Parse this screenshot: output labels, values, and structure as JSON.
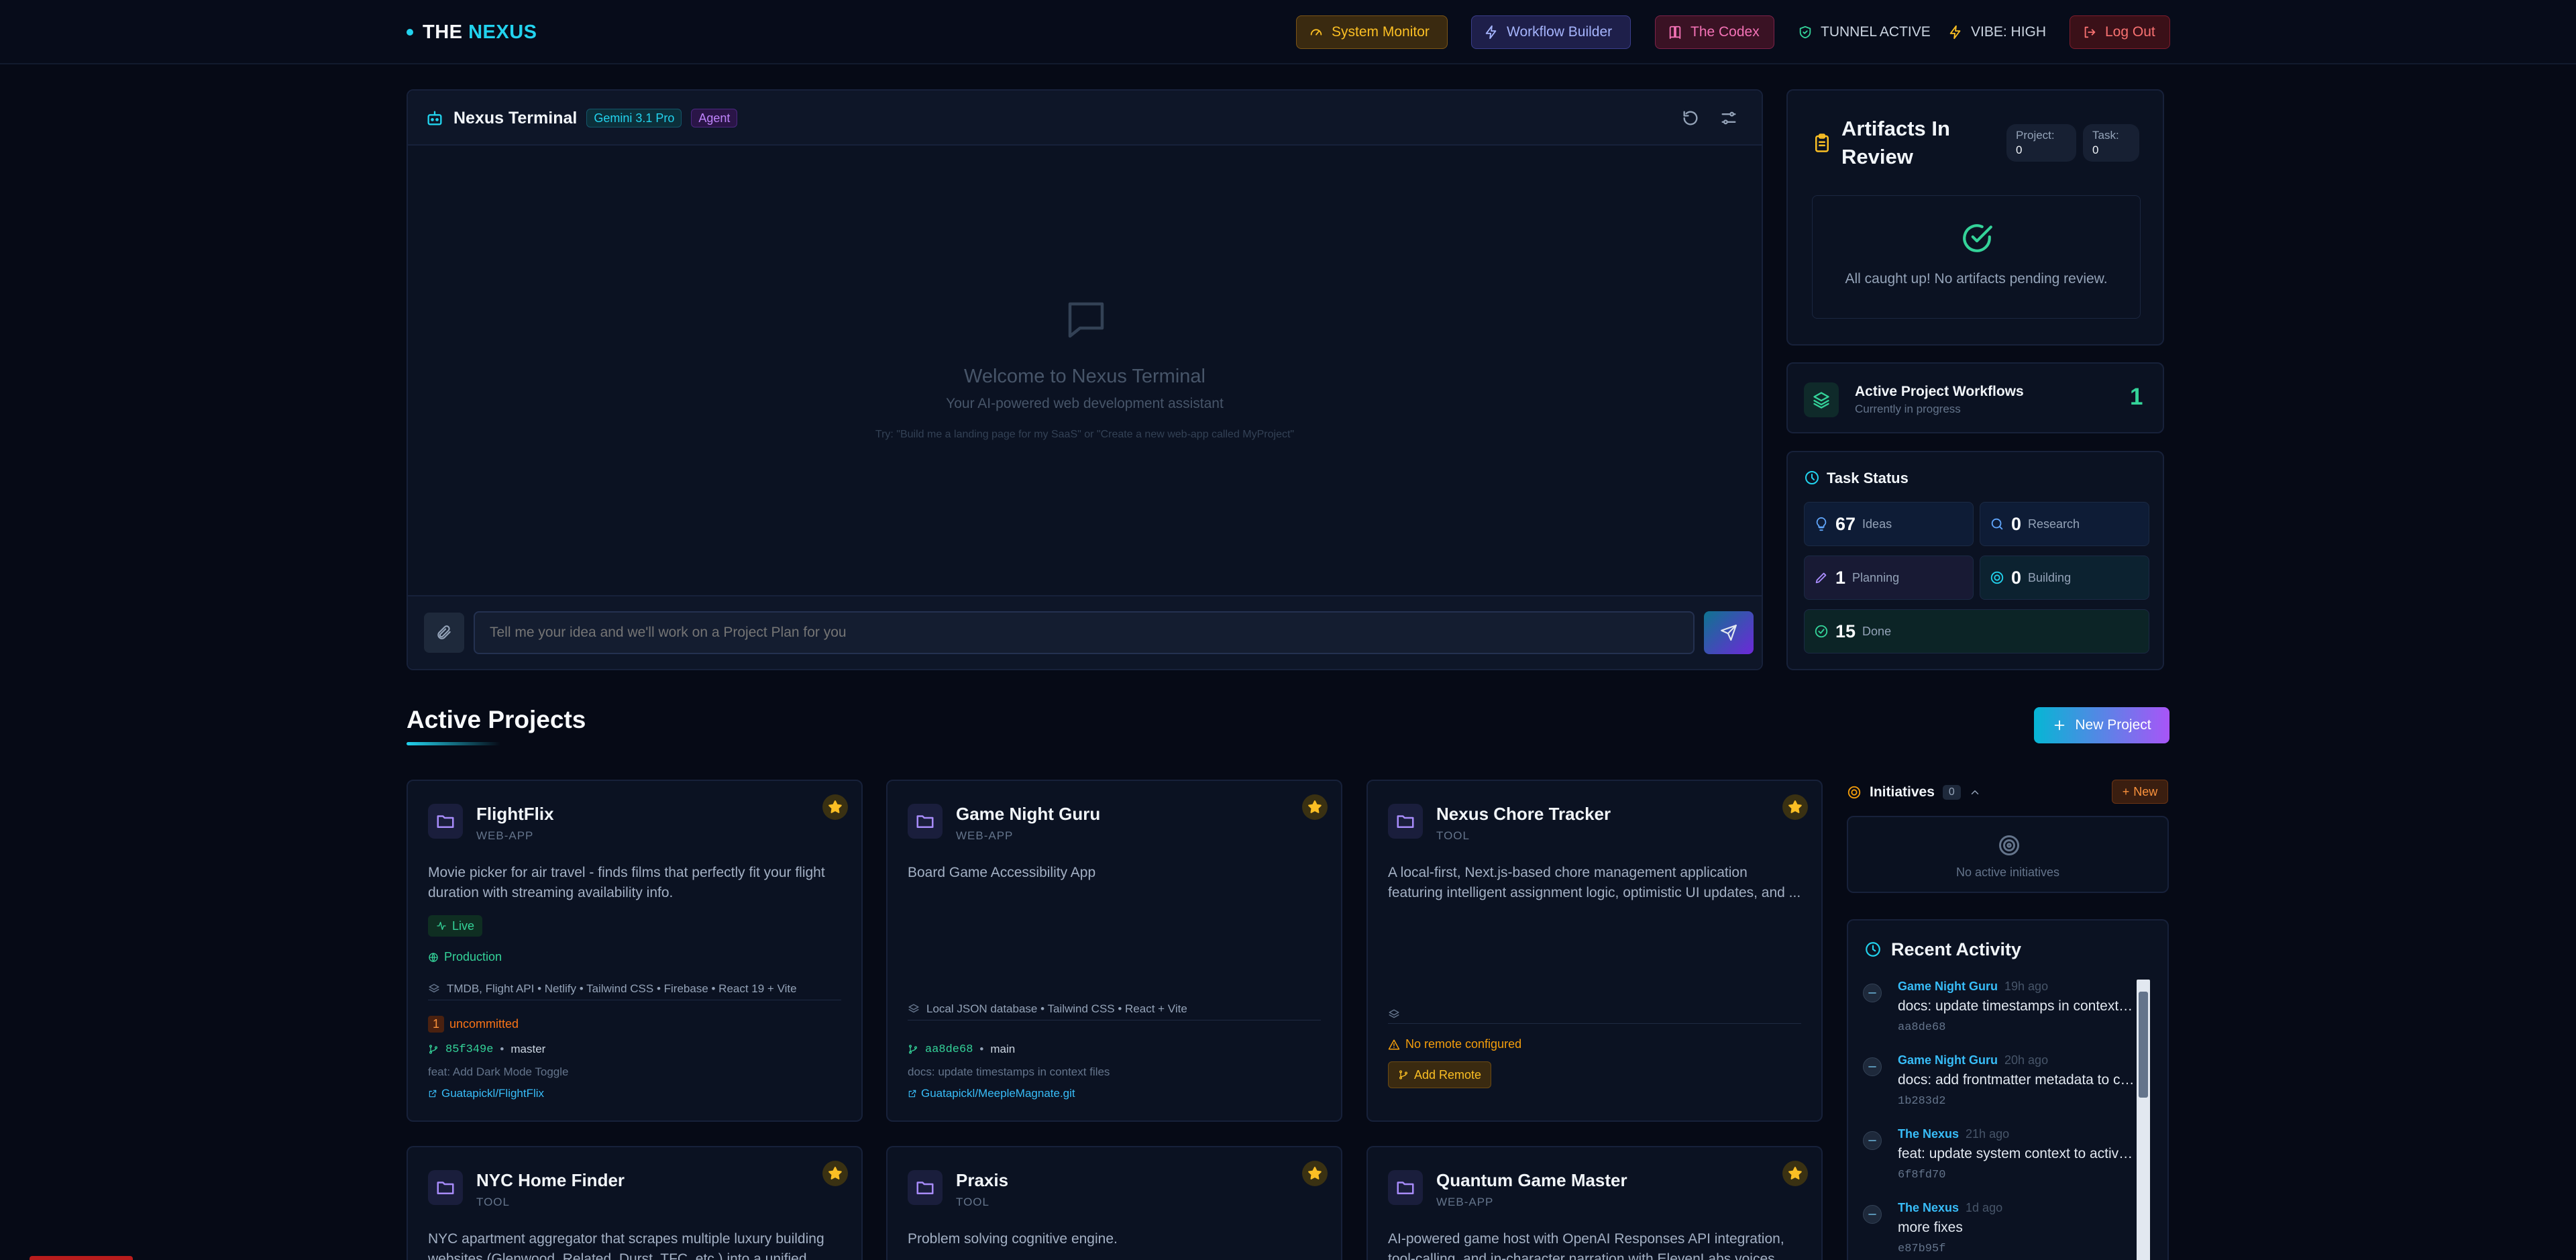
{
  "header": {
    "brand_the": "THE",
    "brand_nexus": "NEXUS",
    "buttons": [
      {
        "label": "System Monitor",
        "icon": "gauge-icon"
      },
      {
        "label": "Workflow Builder",
        "icon": "zap-icon"
      },
      {
        "label": "The Codex",
        "icon": "book-icon"
      }
    ],
    "status_tunnel": "TUNNEL ACTIVE",
    "status_vibe": "VIBE: HIGH",
    "logout_label": "Log Out"
  },
  "terminal": {
    "title": "Nexus Terminal",
    "model_badge": "Gemini 3.1 Pro",
    "mode_badge": "Agent",
    "welcome_title": "Welcome to Nexus Terminal",
    "welcome_subtitle": "Your AI-powered web development assistant",
    "welcome_hint": "Try: \"Build me a landing page for my SaaS\" or \"Create a new web-app called MyProject\"",
    "input_placeholder": "Tell me your idea and we'll work on a Project Plan for you"
  },
  "artifacts": {
    "title": "Artifacts In Review",
    "project_label": "Project:",
    "project_count": "0",
    "task_label": "Task:",
    "task_count": "0",
    "empty_text": "All caught up! No artifacts pending review."
  },
  "workflows": {
    "title": "Active Project Workflows",
    "subtitle": "Currently in progress",
    "count": "1"
  },
  "task_status": {
    "title": "Task Status",
    "tiles": [
      {
        "count": "67",
        "label": "Ideas"
      },
      {
        "count": "0",
        "label": "Research"
      },
      {
        "count": "1",
        "label": "Planning"
      },
      {
        "count": "0",
        "label": "Building"
      },
      {
        "count": "15",
        "label": "Done"
      }
    ]
  },
  "projects_section": {
    "title": "Active Projects",
    "new_button": "New Project"
  },
  "projects": [
    {
      "name": "FlightFlix",
      "type": "WEB-APP",
      "description": "Movie picker for air travel - finds films that perfectly fit your flight duration with streaming availability info.",
      "status_badge": "Live",
      "env": "Production",
      "stack": "TMDB, Flight API • Netlify • Tailwind CSS • Firebase • React 19 + Vite",
      "uncommitted_count": "1",
      "uncommitted_label": "uncommitted",
      "commit_sha": "85f349e",
      "branch": "master",
      "commit_msg": "feat: Add Dark Mode Toggle",
      "repo": "Guatapickl/FlightFlix"
    },
    {
      "name": "Game Night Guru",
      "type": "WEB-APP",
      "description": "Board Game Accessibility App",
      "stack": "Local JSON database • Tailwind CSS • React + Vite",
      "commit_sha": "aa8de68",
      "branch": "main",
      "commit_msg": "docs: update timestamps in context files",
      "repo": "Guatapickl/MeepleMagnate.git"
    },
    {
      "name": "Nexus Chore Tracker",
      "type": "TOOL",
      "description": "A local-first, Next.js-based chore management application featuring intelligent assignment logic, optimistic UI updates, and ...",
      "no_remote": "No remote configured",
      "add_remote": "Add Remote"
    },
    {
      "name": "NYC Home Finder",
      "type": "TOOL",
      "description": "NYC apartment aggregator that scrapes multiple luxury building websites (Glenwood, Related, Durst, TFC, etc.) into a unified"
    },
    {
      "name": "Praxis",
      "type": "TOOL",
      "description": "Problem solving cognitive engine."
    },
    {
      "name": "Quantum Game Master",
      "type": "WEB-APP",
      "description": "AI-powered game host with OpenAI Responses API integration, tool-calling, and in-character narration with ElevenLabs voices"
    }
  ],
  "initiatives": {
    "title": "Initiatives",
    "count": "0",
    "new_label": "New",
    "empty_text": "No active initiatives"
  },
  "recent_activity": {
    "title": "Recent Activity",
    "items": [
      {
        "project": "Game Night Guru",
        "time": "19h ago",
        "message": "docs: update timestamps in context files",
        "sha": "aa8de68"
      },
      {
        "project": "Game Night Guru",
        "time": "20h ago",
        "message": "docs: add frontmatter metadata to context files",
        "sha": "1b283d2"
      },
      {
        "project": "The Nexus",
        "time": "21h ago",
        "message": "feat: update system context to active state",
        "sha": "6f8fd70"
      },
      {
        "project": "The Nexus",
        "time": "1d ago",
        "message": "more fixes",
        "sha": "e87b95f"
      }
    ]
  },
  "colors": {
    "accent_cyan": "#22d3ee",
    "accent_purple": "#8b5cf6",
    "success_green": "#34d399",
    "star_gold": "#fbbf24",
    "danger_red": "#f87171"
  }
}
